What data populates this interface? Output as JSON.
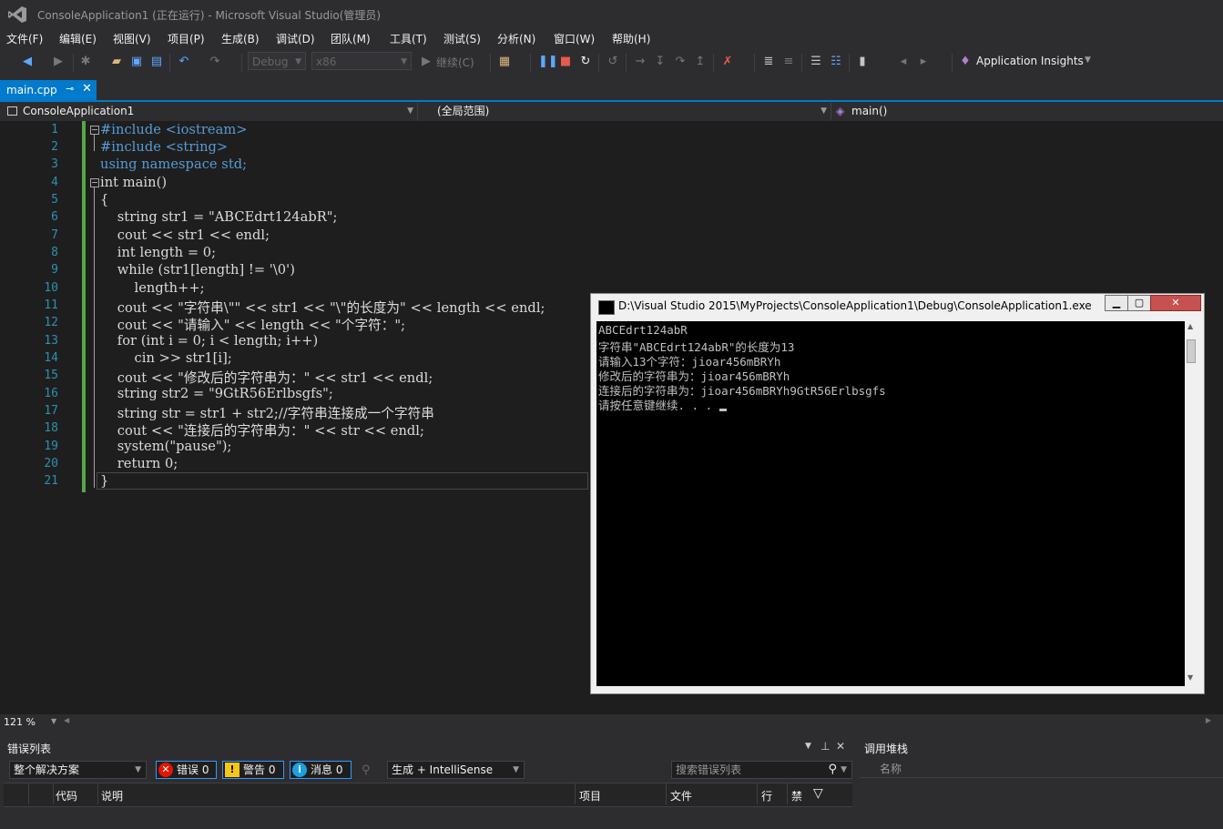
{
  "window": {
    "title": "ConsoleApplication1 (正在运行) - Microsoft Visual Studio(管理员)"
  },
  "menu": [
    "文件(F)",
    "编辑(E)",
    "视图(V)",
    "项目(P)",
    "生成(B)",
    "调试(D)",
    "团队(M)",
    "工具(T)",
    "测试(S)",
    "分析(N)",
    "窗口(W)",
    "帮助(H)"
  ],
  "toolbar": {
    "config": "Debug",
    "platform": "x86",
    "continue_label": "继续(C)",
    "insights_label": "Application Insights"
  },
  "tabs": [
    {
      "label": "main.cpp",
      "active": true
    }
  ],
  "navbar": {
    "project": "ConsoleApplication1",
    "scope": "(全局范围)",
    "member": "main()"
  },
  "code": {
    "line_numbers": [
      "1",
      "2",
      "3",
      "4",
      "5",
      "6",
      "7",
      "8",
      "9",
      "10",
      "11",
      "12",
      "13",
      "14",
      "15",
      "16",
      "17",
      "18",
      "19",
      "20",
      "21"
    ],
    "lines": [
      "#include <iostream>",
      "#include <string>",
      "using namespace std;",
      "int main()",
      "{",
      "    string str1 = \"ABCEdrt124abR\";",
      "    cout << str1 << endl;",
      "    int length = 0;",
      "    while (str1[length] != '\\0')",
      "        length++;",
      "    cout << \"字符串\\\"\" << str1 << \"\\\"的长度为\" << length << endl;",
      "    cout << \"请输入\" << length << \"个字符：\";",
      "    for (int i = 0; i < length; i++)",
      "        cin >> str1[i];",
      "    cout << \"修改后的字符串为：\" << str1 << endl;",
      "    string str2 = \"9GtR56Erlbsgfs\";",
      "    string str = str1 + str2;//字符串连接成一个字符串",
      "    cout << \"连接后的字符串为：\" << str << endl;",
      "    system(\"pause\");",
      "    return 0;",
      "}"
    ]
  },
  "editor": {
    "zoom": "121 %"
  },
  "console": {
    "title": "D:\\Visual Studio 2015\\MyProjects\\ConsoleApplication1\\Debug\\ConsoleApplication1.exe",
    "lines": [
      "ABCEdrt124abR",
      "字符串\"ABCEdrt124abR\"的长度为13",
      "请输入13个字符：jioar456mBRYh",
      "修改后的字符串为：jioar456mBRYh",
      "连接后的字符串为：jioar456mBRYh9GtR56Erlbsgfs",
      "请按任意键继续. . . "
    ]
  },
  "error_list": {
    "title": "错误列表",
    "scope": "整个解决方案",
    "errors_label": "错误 0",
    "warnings_label": "警告 0",
    "messages_label": "消息 0",
    "build_filter": "生成 + IntelliSense",
    "search_placeholder": "搜索错误列表",
    "columns": [
      "代码",
      "说明",
      "项目",
      "文件",
      "行",
      "禁"
    ]
  },
  "call_stack": {
    "title": "调用堆栈",
    "columns": [
      "名称"
    ]
  }
}
